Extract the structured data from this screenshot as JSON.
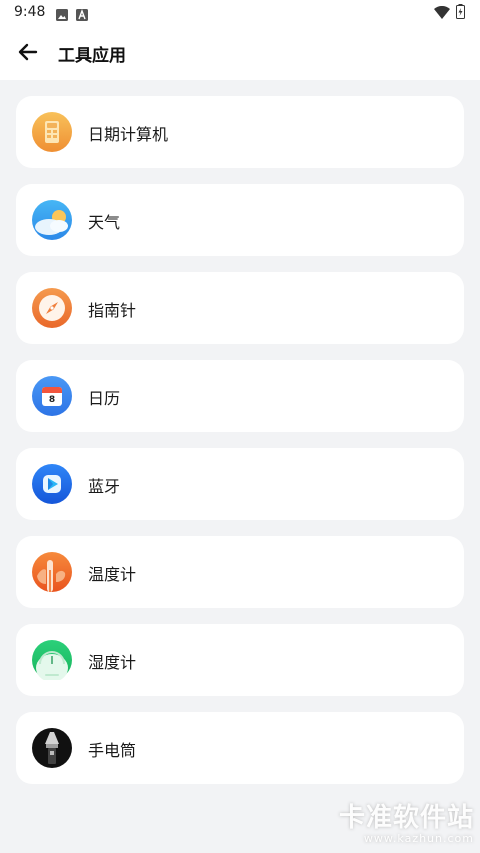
{
  "status_bar": {
    "time": "9:48",
    "icons": [
      "image-icon",
      "a-icon",
      "wifi-icon",
      "battery-icon"
    ]
  },
  "app_bar": {
    "title": "工具应用",
    "back_icon": "arrow-back-icon"
  },
  "tools": [
    {
      "label": "日期计算机",
      "icon": "date-calculator-icon",
      "color": "#f2a646"
    },
    {
      "label": "天气",
      "icon": "weather-icon",
      "color": "#3fa4f0"
    },
    {
      "label": "指南针",
      "icon": "compass-icon",
      "color": "#f07f3c"
    },
    {
      "label": "日历",
      "icon": "calendar-icon",
      "color": "#3b86f0",
      "calendar_day": "8"
    },
    {
      "label": "蓝牙",
      "icon": "bluetooth-icon",
      "color": "#1f6ef0"
    },
    {
      "label": "温度计",
      "icon": "thermometer-icon",
      "color": "#f06a2e"
    },
    {
      "label": "湿度计",
      "icon": "hygrometer-icon",
      "color": "#24c46b"
    },
    {
      "label": "手电筒",
      "icon": "flashlight-icon",
      "color": "#111111"
    }
  ],
  "watermark": {
    "main": "卡准软件站",
    "sub": "www.kazhun.com"
  }
}
